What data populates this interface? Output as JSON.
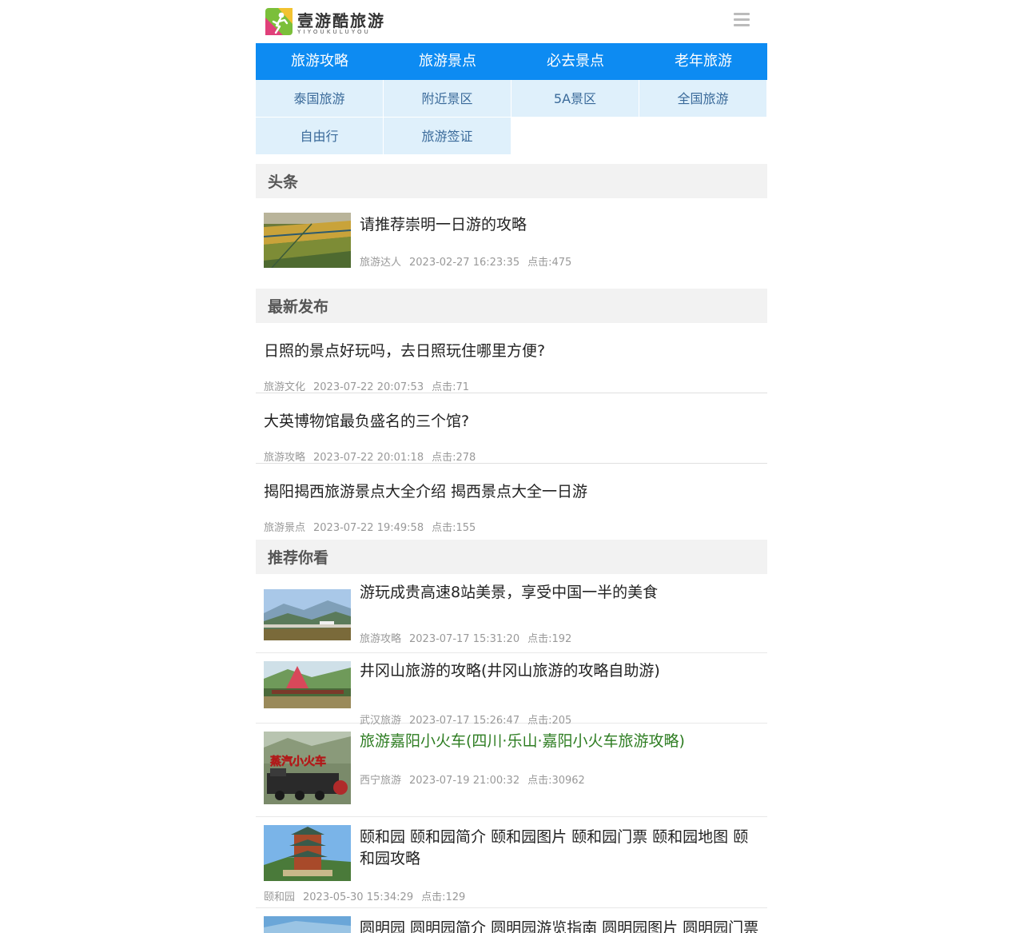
{
  "header": {
    "logo_text": "壹游酷旅游",
    "logo_sub": "YIYOUKULUYOU"
  },
  "nav": {
    "primary": [
      "旅游攻略",
      "旅游景点",
      "必去景点",
      "老年旅游"
    ],
    "secondary": [
      "泰国旅游",
      "附近景区",
      "5A景区",
      "全国旅游",
      "自由行",
      "旅游签证"
    ]
  },
  "sections": {
    "headline": {
      "title": "头条",
      "items": [
        {
          "title": "请推荐崇明一日游的攻略",
          "category": "旅游达人",
          "time": "2023-02-27 16:23:35",
          "clicks": "点击:475"
        }
      ]
    },
    "latest": {
      "title": "最新发布",
      "items": [
        {
          "title": "日照的景点好玩吗，去日照玩住哪里方便?",
          "category": "旅游文化",
          "time": "2023-07-22 20:07:53",
          "clicks": "点击:71"
        },
        {
          "title": "大英博物馆最负盛名的三个馆?",
          "category": "旅游攻略",
          "time": "2023-07-22 20:01:18",
          "clicks": "点击:278"
        },
        {
          "title": "揭阳揭西旅游景点大全介绍 揭西景点大全一日游",
          "category": "旅游景点",
          "time": "2023-07-22 19:49:58",
          "clicks": "点击:155"
        }
      ]
    },
    "recommend": {
      "title": "推荐你看",
      "items": [
        {
          "title": "游玩成贵高速8站美景，享受中国一半的美食",
          "category": "旅游攻略",
          "time": "2023-07-17 15:31:20",
          "clicks": "点击:192"
        },
        {
          "title": "井冈山旅游的攻略(井冈山旅游的攻略自助游)",
          "category": "武汉旅游",
          "time": "2023-07-17 15:26:47",
          "clicks": "点击:205"
        },
        {
          "title": "旅游嘉阳小火车(四川·乐山·嘉阳小火车旅游攻略)",
          "category": "西宁旅游",
          "time": "2023-07-19 21:00:32",
          "clicks": "点击:30962",
          "thumb_caption": "蒸汽小火车"
        },
        {
          "title": "颐和园 颐和园简介 颐和园图片 颐和园门票 颐和园地图 颐和园攻略",
          "category": "颐和园",
          "time": "2023-05-30 15:34:29",
          "clicks": "点击:129"
        },
        {
          "title": "圆明园 圆明园简介 圆明园游览指南 圆明园图片 圆明园门票"
        }
      ]
    }
  },
  "colors": {
    "nav_primary": "#0d8bf2",
    "nav_secondary_bg": "#dff0fb",
    "nav_secondary_text": "#3a6a9a",
    "highlight_title": "#2e7d22"
  }
}
